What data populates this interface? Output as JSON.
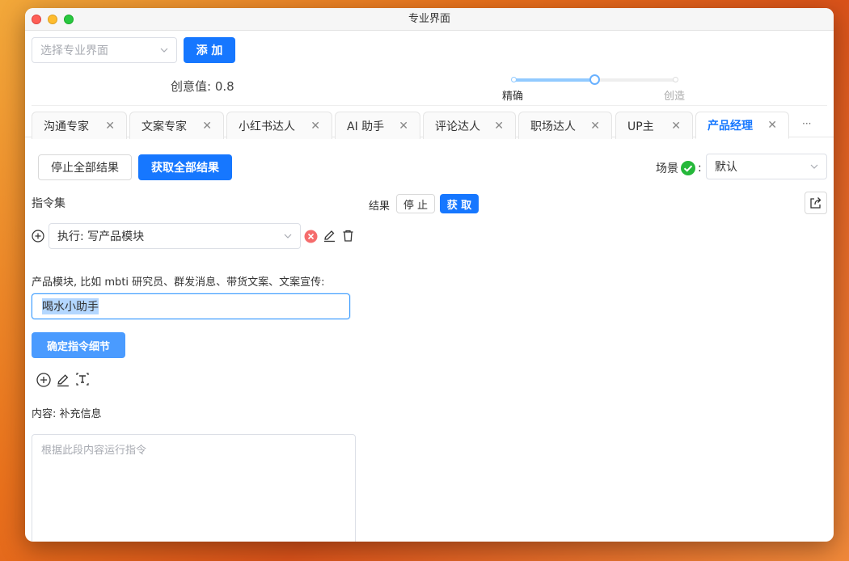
{
  "window": {
    "title": "专业界面"
  },
  "toolbar": {
    "select_placeholder": "选择专业界面",
    "add_label": "添 加"
  },
  "creativity": {
    "label": "创意值: 0.8",
    "left_label": "精确",
    "right_label": "创造"
  },
  "tabs": [
    {
      "label": "沟通专家"
    },
    {
      "label": "文案专家"
    },
    {
      "label": "小红书达人"
    },
    {
      "label": "AI 助手"
    },
    {
      "label": "评论达人"
    },
    {
      "label": "职场达人"
    },
    {
      "label": "UP主"
    },
    {
      "label": "产品经理",
      "active": true
    }
  ],
  "tabs_more": "···",
  "actions": {
    "stop_all": "停止全部结果",
    "get_all": "获取全部结果",
    "scene_label": "场景",
    "scene_colon": ":",
    "scene_value": "默认"
  },
  "instructions": {
    "title": "指令集",
    "selected": "执行: 写产品模块",
    "field_label": "产品模块, 比如 mbti 研究员、群发消息、带货文案、文案宣传:",
    "field_value": "喝水小助手",
    "confirm_label": "确定指令细节",
    "content_label": "内容: 补充信息",
    "content_placeholder": "根据此段内容运行指令"
  },
  "result": {
    "label": "结果",
    "stop": "停 止",
    "get": "获 取"
  },
  "colors": {
    "primary": "#1677ff",
    "success": "#25b83a",
    "danger": "#f56c6c"
  }
}
